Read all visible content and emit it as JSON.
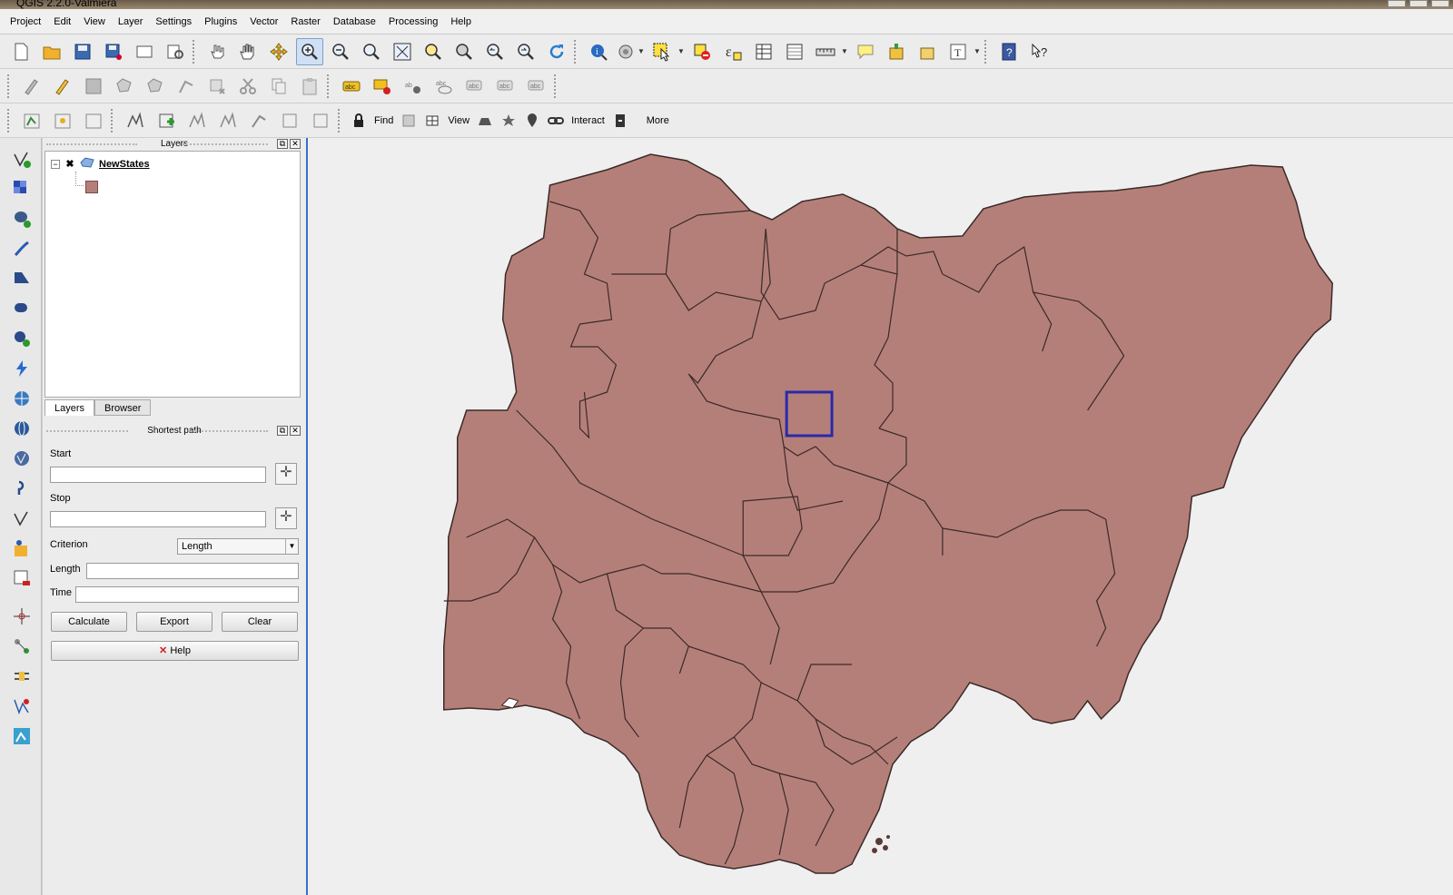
{
  "window": {
    "title": "QGIS 2.2.0-Valmiera"
  },
  "menu": [
    "Project",
    "Edit",
    "View",
    "Layer",
    "Settings",
    "Plugins",
    "Vector",
    "Raster",
    "Database",
    "Processing",
    "Help"
  ],
  "toolbar3": {
    "find": "Find",
    "view": "View",
    "interact": "Interact",
    "more": "More"
  },
  "layers_panel": {
    "title": "Layers",
    "layer": {
      "name": "NewStates",
      "color": "#b57f79"
    },
    "tabs": [
      "Layers",
      "Browser"
    ]
  },
  "shortest_path": {
    "title": "Shortest path",
    "start_label": "Start",
    "stop_label": "Stop",
    "criterion_label": "Criterion",
    "criterion_value": "Length",
    "length_label": "Length",
    "time_label": "Time",
    "calculate": "Calculate",
    "export": "Export",
    "clear": "Clear",
    "help": "Help"
  },
  "map": {
    "fill_color": "#b57f79",
    "stroke_color": "#3a2a28",
    "selection_color": "#2a2aa8"
  }
}
